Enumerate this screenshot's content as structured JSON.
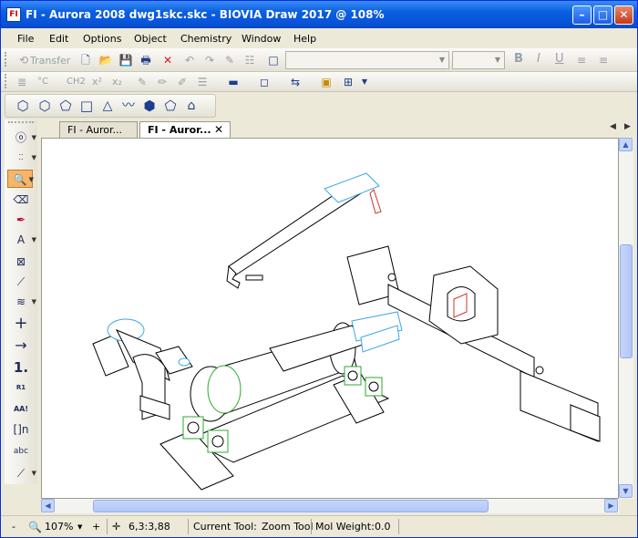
{
  "window": {
    "title": "FI - Aurora 2008 dwg1skc.skc - BIOVIA Draw 2017  @ 108%",
    "icon": "app-icon"
  },
  "titlebar_buttons": {
    "minimize": "–",
    "maximize": "□",
    "close": "✕"
  },
  "menu": [
    "File",
    "Edit",
    "Options",
    "Object",
    "Chemistry",
    "Window",
    "Help"
  ],
  "toolbar": {
    "transfer_label": "Transfer",
    "font_combo_value": "",
    "size_combo_value": "",
    "bold": "B",
    "italic": "I",
    "underline": "U"
  },
  "toolbar2": {
    "celsius_label": "°C",
    "ch2_label": "CH2",
    "x2_label": "x²",
    "x2_sub_label": "x₂"
  },
  "tabs": [
    {
      "label": "FI - Auror...",
      "active": false
    },
    {
      "label": "FI - Auror...",
      "active": true
    }
  ],
  "tab_close": "✕",
  "left_tools": {
    "superatom_label": "Atom Label",
    "bond_order_label": "1.",
    "rgroup_label": "R1",
    "aa_label": "AA!",
    "bracket_label": "[]n",
    "text_label": "abc"
  },
  "status": {
    "zoom_out": "-",
    "zoom_value": "107%",
    "zoom_in": "+",
    "coords": "6,3:3,88",
    "current_tool_label": "Current Tool:",
    "current_tool_value": "Zoom Tool",
    "mol_weight_label": "Mol Weight:",
    "mol_weight_value": "0.0"
  },
  "colors": {
    "accent": "#f6b66a",
    "titlebar": "#0a5fe0",
    "drawing_blue": "#39a7e8",
    "drawing_green": "#2ea82e",
    "drawing_red": "#d0342c"
  }
}
